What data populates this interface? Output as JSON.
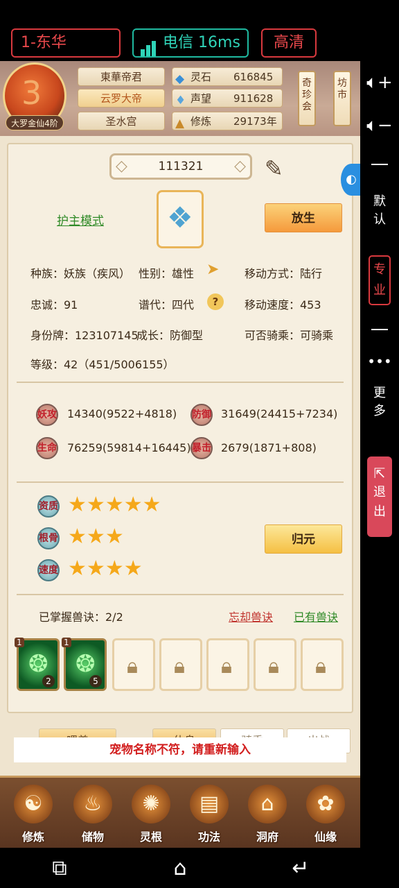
{
  "topbar": {
    "server": "1-东华",
    "network": "电信 16ms",
    "quality": "高清"
  },
  "player": {
    "rank": "大罗金仙4阶",
    "titles": [
      "東華帝君",
      "云罗大帝",
      "圣水宫"
    ],
    "stats": [
      {
        "label": "灵石",
        "value": "616845",
        "icon": "spirit-stone-icon"
      },
      {
        "label": "声望",
        "value": "911628",
        "icon": "reputation-icon"
      },
      {
        "label": "修炼",
        "value": "29173年",
        "icon": "cultivation-icon"
      }
    ],
    "banners": [
      "奇珍会",
      "坊市"
    ]
  },
  "pet": {
    "name": "111321",
    "mode_link": "护主模式",
    "release_label": "放生",
    "info": {
      "race": "种族：妖族（疾风）",
      "gender": "性别：雄性",
      "move_type": "移动方式：陆行",
      "loyalty": "忠诚：91",
      "generation": "谱代：四代",
      "move_speed": "移动速度：453",
      "id_card": "身份牌：123107145",
      "growth": "成长：防御型",
      "rideable": "可否骑乘：可骑乘",
      "level": "等级：42（451/5006155）"
    },
    "attributes": [
      {
        "label": "妖攻",
        "value": "14340(9522+4818)"
      },
      {
        "label": "防御",
        "value": "31649(24415+7234)"
      },
      {
        "label": "生命",
        "value": "76259(59814+16445)"
      },
      {
        "label": "暴击",
        "value": "2679(1871+808)"
      }
    ],
    "qualities": [
      {
        "label": "资质",
        "stars": 5
      },
      {
        "label": "根骨",
        "stars": 3
      },
      {
        "label": "速度",
        "stars": 4
      }
    ],
    "guiyuan_label": "归元",
    "skills": {
      "mastered": "已掌握兽诀：2/2",
      "forget_link": "忘却兽诀",
      "owned_link": "已有兽诀",
      "slots": [
        {
          "type": "skill",
          "level": "1",
          "count": "2"
        },
        {
          "type": "skill",
          "level": "1",
          "count": "5"
        },
        {
          "type": "locked"
        },
        {
          "type": "locked"
        },
        {
          "type": "locked"
        },
        {
          "type": "locked"
        },
        {
          "type": "locked"
        }
      ]
    }
  },
  "action_tabs": [
    "喂养",
    "休息",
    "骑乘",
    "出战"
  ],
  "toast": "宠物名称不符，请重新输入",
  "bottom_nav": [
    {
      "label": "修炼",
      "icon": "cultivate-icon"
    },
    {
      "label": "储物",
      "icon": "storage-bag-icon"
    },
    {
      "label": "灵根",
      "icon": "spirit-root-icon"
    },
    {
      "label": "功法",
      "icon": "technique-book-icon"
    },
    {
      "label": "洞府",
      "icon": "cave-house-icon"
    },
    {
      "label": "仙缘",
      "icon": "immortal-fate-icon"
    }
  ],
  "side_panel": {
    "default": "默认",
    "pro": "专业",
    "more": "更多",
    "exit": "退出"
  },
  "colors": {
    "accent_red": "#e8484b",
    "accent_teal": "#2fd3b8",
    "star": "#f5a81a"
  }
}
